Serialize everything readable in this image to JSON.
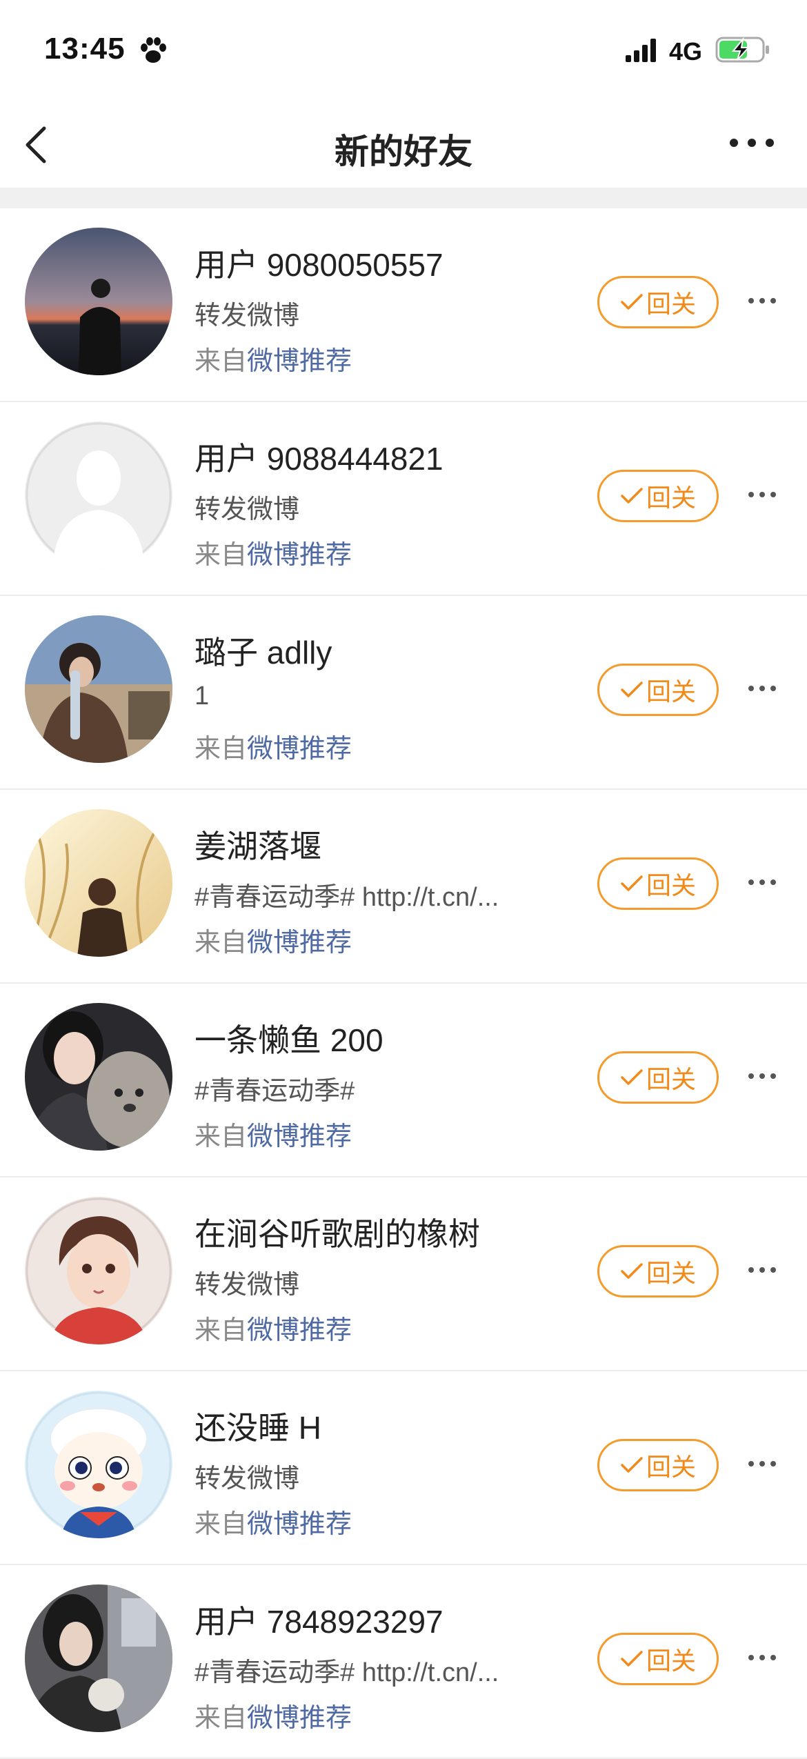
{
  "status_bar": {
    "time": "13:45",
    "network": "4G"
  },
  "nav": {
    "title": "新的好友"
  },
  "rows": [
    {
      "name": "用户 9080050557",
      "desc": "转发微博",
      "source_prefix": "来自",
      "source_link": "微博推荐",
      "button": "回关"
    },
    {
      "name": "用户 9088444821",
      "desc": "转发微博",
      "source_prefix": "来自",
      "source_link": "微博推荐",
      "button": "回关"
    },
    {
      "name": "璐子 adlly",
      "desc": "1",
      "source_prefix": "来自",
      "source_link": "微博推荐",
      "button": "回关"
    },
    {
      "name": "姜湖落堰",
      "desc": "#青春运动季# http://t.cn/...",
      "source_prefix": "来自",
      "source_link": "微博推荐",
      "button": "回关"
    },
    {
      "name": "一条懒鱼 200",
      "desc": "#青春运动季#",
      "source_prefix": "来自",
      "source_link": "微博推荐",
      "button": "回关"
    },
    {
      "name": "在涧谷听歌剧的橡树",
      "desc": "转发微博",
      "source_prefix": "来自",
      "source_link": "微博推荐",
      "button": "回关"
    },
    {
      "name": "还没睡 H",
      "desc": "转发微博",
      "source_prefix": "来自",
      "source_link": "微博推荐",
      "button": "回关"
    },
    {
      "name": "用户 7848923297",
      "desc": "#青春运动季# http://t.cn/...",
      "source_prefix": "来自",
      "source_link": "微博推荐",
      "button": "回关"
    }
  ],
  "colors": {
    "accent": "#f28a1a",
    "link": "#4f6aa3",
    "battery": "#4cd964"
  }
}
